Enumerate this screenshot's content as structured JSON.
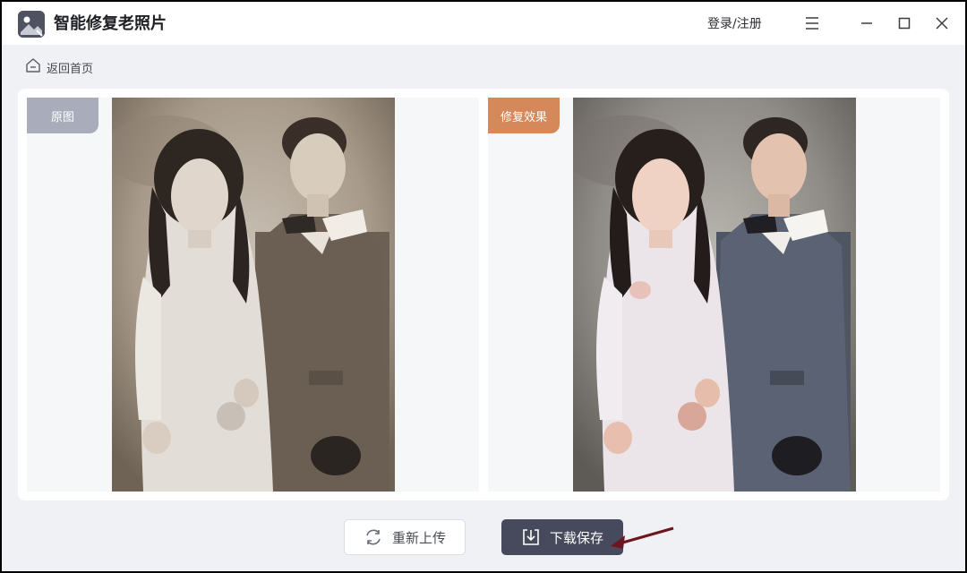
{
  "app": {
    "title": "智能修复老照片",
    "login_label": "登录/注册"
  },
  "nav": {
    "back_label": "返回首页"
  },
  "panels": {
    "original_tag": "原图",
    "result_tag": "修复效果"
  },
  "actions": {
    "reupload_label": "重新上传",
    "save_label": "下载保存"
  },
  "colors": {
    "accent_orange": "#d58859",
    "tag_gray": "#a9adbb",
    "save_button": "#474a5c",
    "annotation_arrow": "#6e1520"
  },
  "icons": [
    "app-logo-icon",
    "menu-icon",
    "minimize-icon",
    "maximize-icon",
    "close-icon",
    "home-icon",
    "refresh-icon",
    "download-icon"
  ]
}
